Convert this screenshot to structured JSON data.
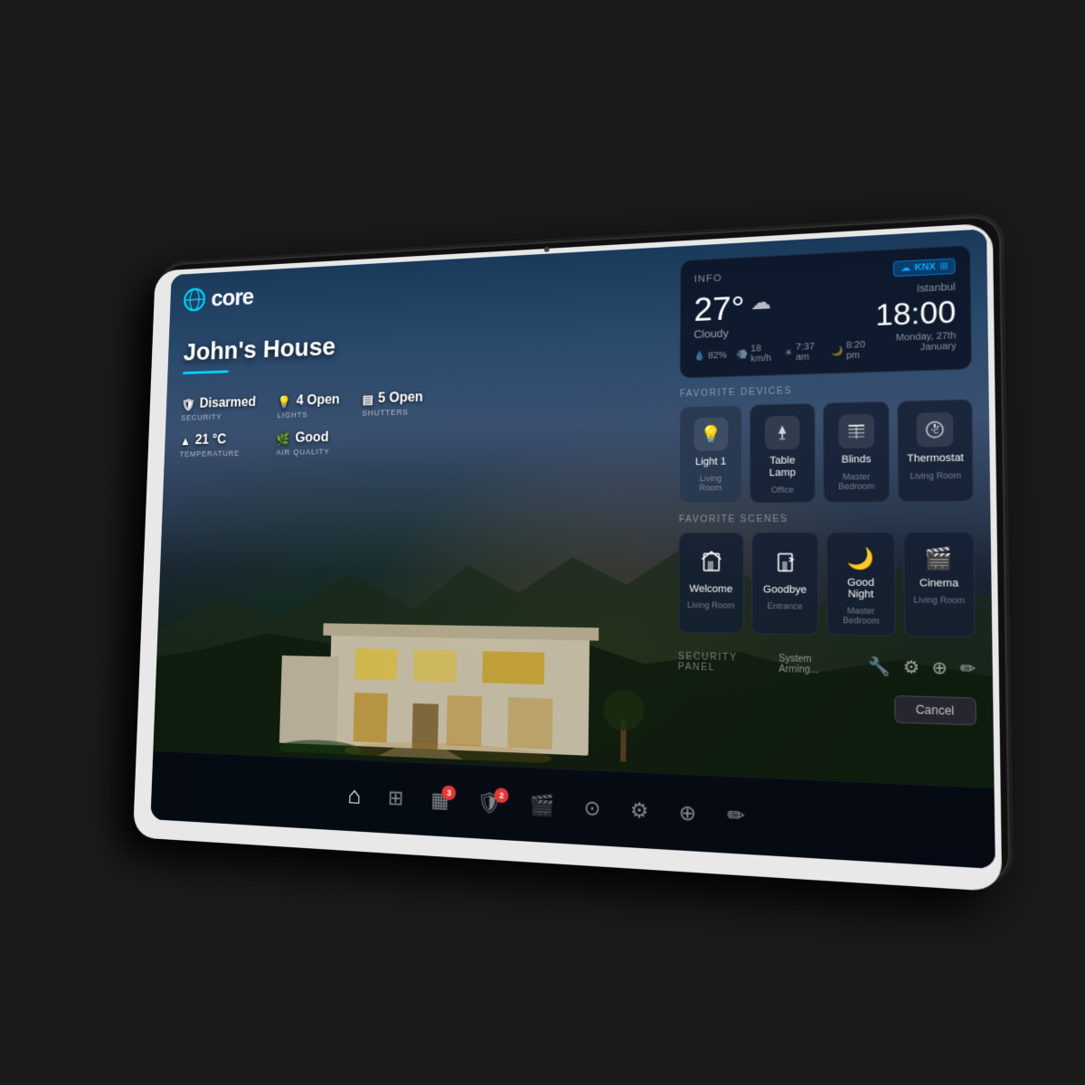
{
  "app": {
    "name": "core",
    "logo_icon": "○"
  },
  "header": {
    "knx_label": "KNX"
  },
  "house": {
    "name": "John's House",
    "status": {
      "security_value": "Disarmed",
      "security_label": "SECURITY",
      "lights_value": "4 Open",
      "lights_label": "LIGHTS",
      "shutters_value": "5 Open",
      "shutters_label": "SHUTTERS",
      "temperature_value": "21 °C",
      "temperature_label": "TEMPERATURE",
      "air_quality_value": "Good",
      "air_quality_label": "AIR QUALITY"
    }
  },
  "weather": {
    "info_label": "INFO",
    "temperature": "27°",
    "unit": "",
    "condition": "Cloudy",
    "humidity": "82%",
    "wind": "18 km/h",
    "sunrise": "7:37 am",
    "sunset": "8:20 pm",
    "city": "Istanbul",
    "time": "18:00",
    "date": "Monday, 27th January"
  },
  "favorite_devices": {
    "section_title": "FAVORITE DEVICES",
    "items": [
      {
        "name": "Light 1",
        "room": "Living Room",
        "icon": "💡",
        "active": true
      },
      {
        "name": "Table Lamp",
        "room": "Office",
        "icon": "🪔",
        "active": false
      },
      {
        "name": "Blinds",
        "room": "Master Bedroom",
        "icon": "▤",
        "active": false
      },
      {
        "name": "Thermostat",
        "room": "Living Room",
        "icon": "🌡",
        "active": false
      }
    ]
  },
  "favorite_scenes": {
    "section_title": "FAVORITE SCENES",
    "items": [
      {
        "name": "Welcome",
        "room": "Living Room",
        "icon": "🚪"
      },
      {
        "name": "Goodbye",
        "room": "Entrance",
        "icon": "🚶"
      },
      {
        "name": "Good Night",
        "room": "Master Bedroom",
        "icon": "🌙"
      },
      {
        "name": "Cinema",
        "room": "Living Room",
        "icon": "🎬"
      }
    ]
  },
  "security_panel": {
    "title": "SECURITY PANEL",
    "system_arming": "System Arming...",
    "cancel_label": "Cancel"
  },
  "bottom_nav": {
    "items": [
      {
        "icon": "⌂",
        "label": "home",
        "active": true,
        "badge": null
      },
      {
        "icon": "⊞",
        "label": "apps",
        "active": false,
        "badge": null
      },
      {
        "icon": "▦",
        "label": "devices",
        "active": false,
        "badge": "3"
      },
      {
        "icon": "🛡",
        "label": "security",
        "active": false,
        "badge": "2"
      },
      {
        "icon": "🎬",
        "label": "media",
        "active": false,
        "badge": null
      },
      {
        "icon": "⊙",
        "label": "clock",
        "active": false,
        "badge": null
      },
      {
        "icon": "⚙",
        "label": "settings",
        "active": false,
        "badge": null
      },
      {
        "icon": "⊕",
        "label": "scenes",
        "active": false,
        "badge": null
      },
      {
        "icon": "✏",
        "label": "edit",
        "active": false,
        "badge": null
      }
    ]
  }
}
